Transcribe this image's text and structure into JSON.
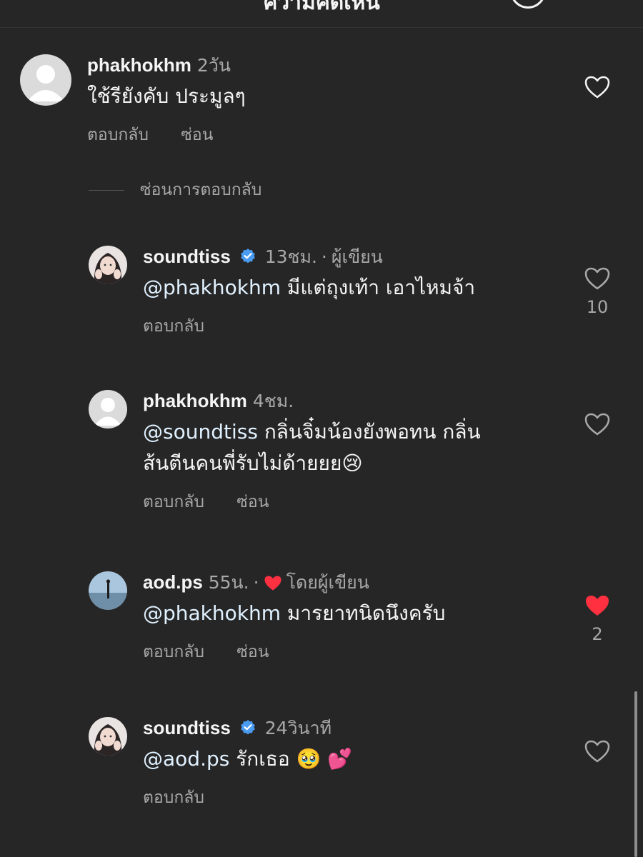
{
  "header": {
    "title": "ความคิดเห็น"
  },
  "comments": [
    {
      "username": "phakhokhm",
      "time": "2วัน",
      "text": "ใช้รียังคับ ประมูลๆ",
      "actions": [
        "ตอบกลับ",
        "ซ่อน"
      ],
      "liked": false
    }
  ],
  "hide_replies_label": "ซ่อนการตอบกลับ",
  "replies": [
    {
      "username": "soundtiss",
      "verified": true,
      "time": "13ชม.",
      "author_tag": "ผู้เขียน",
      "mention": "@phakhokhm",
      "text": " มีแต่ถุงเท้า เอาไหมจ้า",
      "actions": [
        "ตอบกลับ"
      ],
      "like_count": "10",
      "liked": false
    },
    {
      "username": "phakhokhm",
      "time": "4ชม.",
      "mention": "@soundtiss",
      "text": " กลิ่นจิ๋มน้องยังพอทน กลิ่นส้นตีนคนพี่รับไม่ด้ายยย😢",
      "actions": [
        "ตอบกลับ",
        "ซ่อน"
      ],
      "liked": false
    },
    {
      "username": "aod.ps",
      "time": "55น.",
      "author_tag": "โดยผู้เขียน",
      "mention": "@phakhokhm",
      "text": " มารยาทนิดนึงครับ",
      "actions": [
        "ตอบกลับ",
        "ซ่อน"
      ],
      "like_count": "2",
      "liked": true
    },
    {
      "username": "soundtiss",
      "verified": true,
      "time": "24วินาที",
      "mention": "@aod.ps",
      "text": " รักเธอ 🥹 💕",
      "actions": [
        "ตอบกลับ"
      ],
      "liked": false
    }
  ],
  "colors": {
    "background": "#262626",
    "liked_heart": "#ff3040",
    "verified": "#0095f6",
    "secondary_text": "#a8a8a8"
  }
}
